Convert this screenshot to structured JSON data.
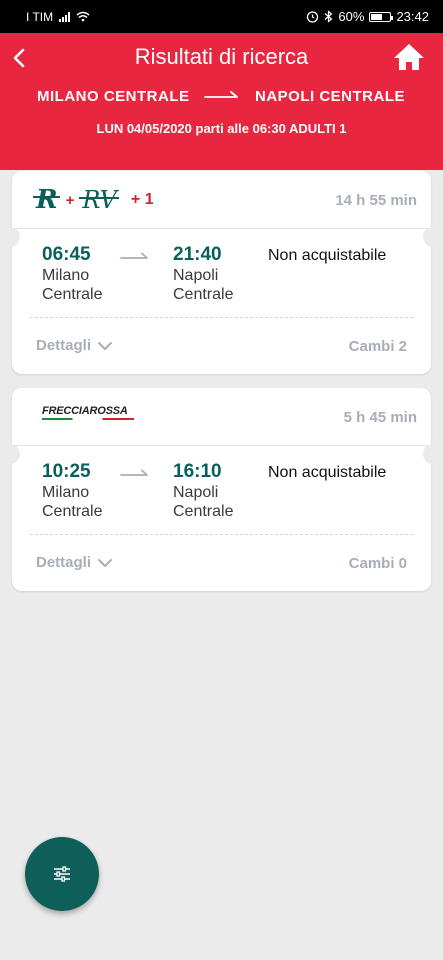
{
  "status_bar": {
    "carrier": "I TIM",
    "battery_percent": "60%",
    "time": "23:42",
    "icons": [
      "signal-icon",
      "wifi-icon",
      "alarm-icon",
      "bluetooth-icon",
      "battery-icon"
    ]
  },
  "header": {
    "title": "Risultati di ricerca",
    "back_icon": "chevron-left-icon",
    "home_icon": "home-icon",
    "origin": "MILANO CENTRALE",
    "destination": "NAPOLI CENTRALE",
    "search_info": "LUN 04/05/2020 parti alle 06:30 ADULTI 1"
  },
  "results": [
    {
      "logos": [
        "R",
        "RV"
      ],
      "plus": "+",
      "extra_trains": "+ 1",
      "duration": "14 h 55 min",
      "departure_time": "06:45",
      "departure_station": [
        "Milano",
        "Centrale"
      ],
      "arrival_time": "21:40",
      "arrival_station": [
        "Napoli",
        "Centrale"
      ],
      "status": "Non acquistabile",
      "details_label": "Dettagli",
      "changes": "Cambi 2"
    },
    {
      "brand": "FRECCIAROSSA",
      "duration": "5 h 45 min",
      "departure_time": "10:25",
      "departure_station": [
        "Milano",
        "Centrale"
      ],
      "arrival_time": "16:10",
      "arrival_station": [
        "Napoli",
        "Centrale"
      ],
      "status": "Non acquistabile",
      "details_label": "Dettagli",
      "changes": "Cambi 0"
    }
  ],
  "fab": {
    "icon": "filter-sliders-icon"
  },
  "colors": {
    "header_red": "#e8263f",
    "accent_teal": "#0b5f5b",
    "muted_gray": "#a8aeb8",
    "trenitalia_red": "#c9242f"
  }
}
